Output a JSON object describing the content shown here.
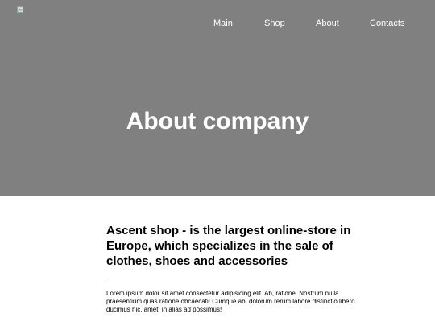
{
  "nav": {
    "items": [
      {
        "label": "Main"
      },
      {
        "label": "Shop"
      },
      {
        "label": "About"
      },
      {
        "label": "Contacts"
      }
    ]
  },
  "hero": {
    "title": "About company",
    "background_color": "#808080",
    "logo_icon": "broken-image-icon"
  },
  "content": {
    "headline": "Ascent shop - is the largest online-store in Europe, which specializes in the sale of clothes, shoes and accessories",
    "body": "Lorem ipsum dolor sit amet consectetur adipisicing elit. Ab, ratione. Nostrum nulla praesentium quas ratione obcaecati! Cumque ab, dolorum rerum labore distinctio libero ducimus hic, amet, in alias ad possimus!"
  }
}
